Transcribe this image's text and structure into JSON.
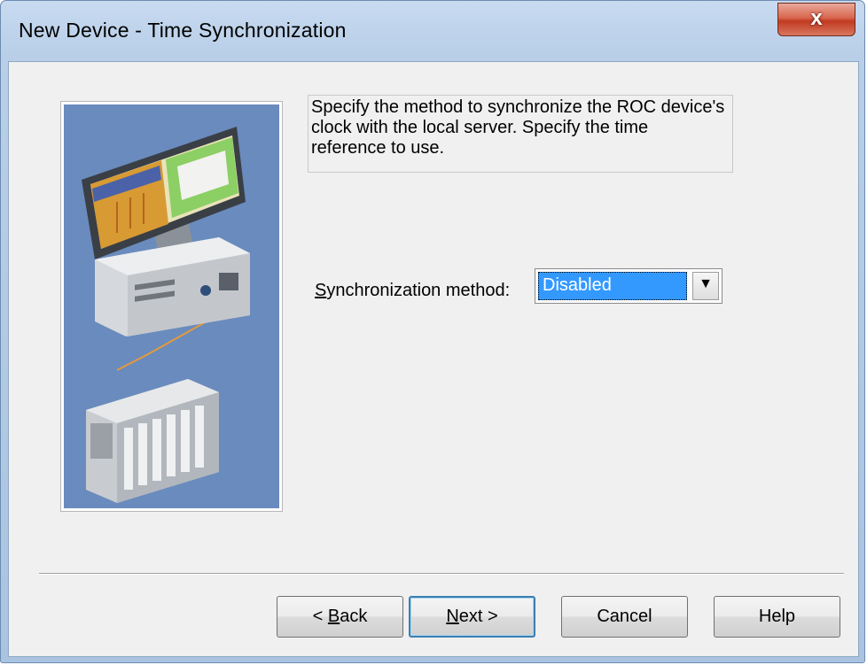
{
  "window": {
    "title": "New Device - Time Synchronization",
    "close_glyph": "x"
  },
  "description": "Specify the method to synchronize the ROC device's clock with the local server.  Specify the time reference to use.",
  "sync": {
    "label_accel": "S",
    "label_rest": "ynchronization method:",
    "selected_value": "Disabled",
    "dropdown_glyph": "▼"
  },
  "buttons": {
    "back_prefix": "< ",
    "back_accel": "B",
    "back_rest": "ack",
    "next_accel": "N",
    "next_rest": "ext >",
    "cancel": "Cancel",
    "help": "Help"
  },
  "icons": {
    "illustration": "computer-and-plc-illustration",
    "close": "close-icon",
    "dropdown": "chevron-down-icon"
  },
  "colors": {
    "titlebar": "#b9cfe8",
    "client_bg": "#f0f0f0",
    "selection": "#3399ff",
    "illustration_bg": "#6a8bbd",
    "close_button": "#c23a22"
  }
}
